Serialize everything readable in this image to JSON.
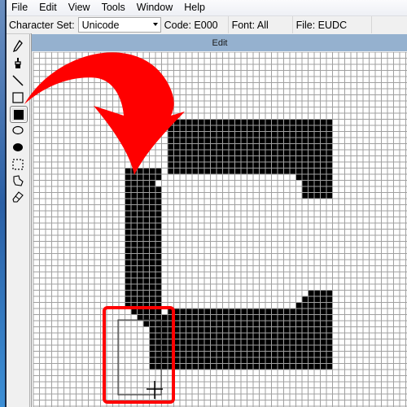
{
  "menubar": {
    "items": [
      "File",
      "Edit",
      "View",
      "Tools",
      "Window",
      "Help"
    ]
  },
  "toolbar": {
    "character_set_label": "Character Set:",
    "character_set_value": "Unicode",
    "code": "Code: E000",
    "font": "Font: All",
    "file": "File: EUDC"
  },
  "tools": [
    {
      "name": "pencil",
      "selected": false
    },
    {
      "name": "brush",
      "selected": false
    },
    {
      "name": "line",
      "selected": false
    },
    {
      "name": "hollow-rectangle",
      "selected": false
    },
    {
      "name": "filled-rectangle",
      "selected": true
    },
    {
      "name": "hollow-ellipse",
      "selected": false
    },
    {
      "name": "filled-ellipse",
      "selected": false
    },
    {
      "name": "rectangular-selection",
      "selected": false
    },
    {
      "name": "freeform-selection",
      "selected": false
    },
    {
      "name": "eraser",
      "selected": false
    }
  ],
  "edit_window": {
    "title": "Edit"
  },
  "glyph": {
    "description": "Partially drawn letter C in black pixels on a 64x64 edit grid",
    "colors": {
      "pixel_on": "#000000",
      "pixel_off": "#ffffff",
      "grid_line": "#a0a0a0"
    }
  },
  "annotations": {
    "arrow_color": "#ff0000",
    "highlight_box_color": "#ff0000"
  }
}
